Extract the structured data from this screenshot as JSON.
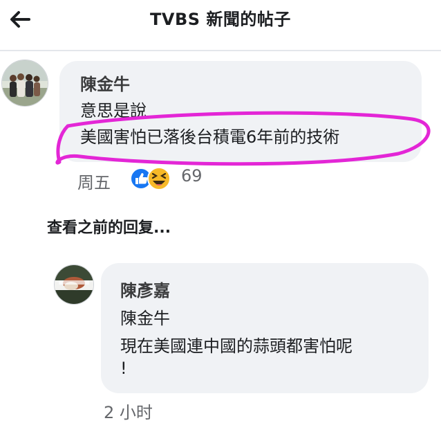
{
  "header": {
    "title": "TVBS 新聞的帖子",
    "back_icon": "arrow-left-icon"
  },
  "comment": {
    "author": "陳金牛",
    "lines": [
      "意思是說",
      "美國害怕已落後台積電6年前的技術"
    ],
    "time": "周五",
    "reaction_icons": [
      "like-icon",
      "haha-icon"
    ],
    "reaction_count": "69",
    "highlight_color": "#e326d6"
  },
  "view_previous_replies": "查看之前的回复...",
  "reply": {
    "author": "陳彥嘉",
    "lines": [
      "陳金牛",
      "現在美國連中國的蒜頭都害怕呢",
      "!"
    ],
    "time": "2 小时"
  },
  "colors": {
    "bubble": "#f0f2f5",
    "like_blue": "#1877f2",
    "haha_yellow": "#f7b928",
    "meta_gray": "#65676b"
  }
}
